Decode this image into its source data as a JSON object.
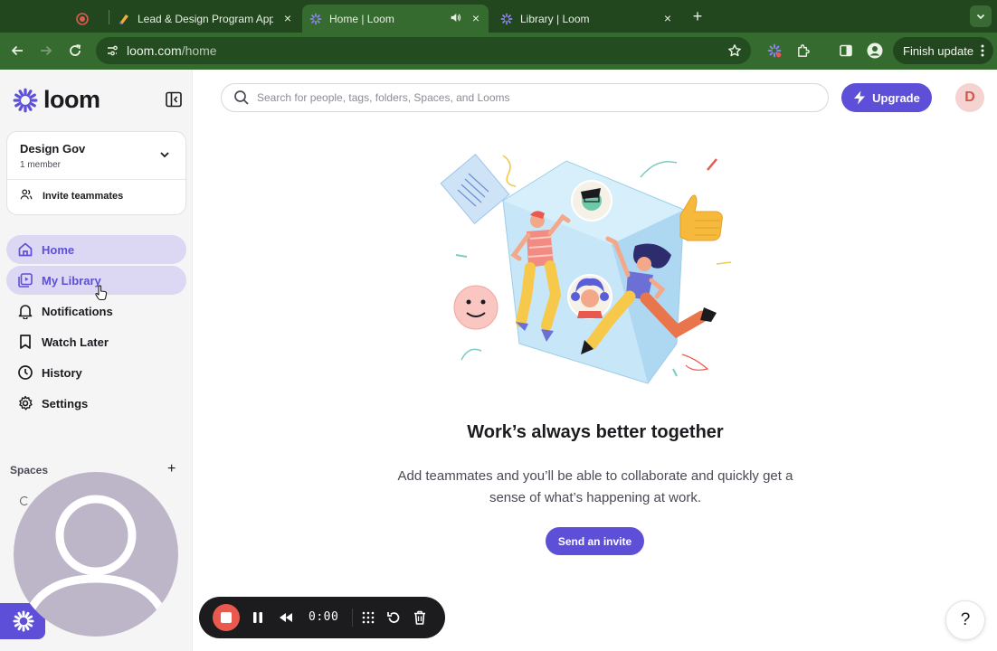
{
  "browser": {
    "tabs": [
      {
        "title": "",
        "icon": "recording-icon",
        "active": false
      },
      {
        "title": "Lead & Design Program Appli",
        "icon": "slides-icon",
        "active": false
      },
      {
        "title": "Home | Loom",
        "icon": "loom-icon",
        "active": true,
        "audio": true
      },
      {
        "title": "Library | Loom",
        "icon": "loom-icon",
        "active": false
      }
    ],
    "url_host": "loom.com",
    "url_path": "/home",
    "finish_update_label": "Finish update"
  },
  "sidebar": {
    "brand": "loom",
    "workspace": {
      "name": "Design Gov",
      "members": "1 member"
    },
    "invite_label": "Invite teammates",
    "nav": [
      {
        "label": "Home",
        "icon": "home-icon",
        "state": "active"
      },
      {
        "label": "My Library",
        "icon": "library-icon",
        "state": "hover"
      },
      {
        "label": "Notifications",
        "icon": "bell-icon",
        "state": ""
      },
      {
        "label": "Watch Later",
        "icon": "bookmark-icon",
        "state": ""
      },
      {
        "label": "History",
        "icon": "clock-icon",
        "state": ""
      },
      {
        "label": "Settings",
        "icon": "gear-icon",
        "state": ""
      }
    ],
    "spaces_label": "Spaces",
    "spaces_add": "+"
  },
  "header": {
    "search_placeholder": "Search for people, tags, folders, Spaces, and Looms",
    "upgrade_label": "Upgrade",
    "avatar_initial": "D"
  },
  "empty_state": {
    "title": "Work’s always better together",
    "description": "Add teammates and you’ll be able to collaborate and quickly get a sense of what’s happening at work.",
    "cta": "Send an invite"
  },
  "recorder": {
    "time": "0:00"
  },
  "help_label": "?",
  "colors": {
    "brand": "#5d4fd8",
    "nav_active_bg": "#dcd8f3",
    "browser_tab_bar": "#22471f",
    "browser_toolbar": "#356b2f",
    "record_red": "#e9594d"
  }
}
